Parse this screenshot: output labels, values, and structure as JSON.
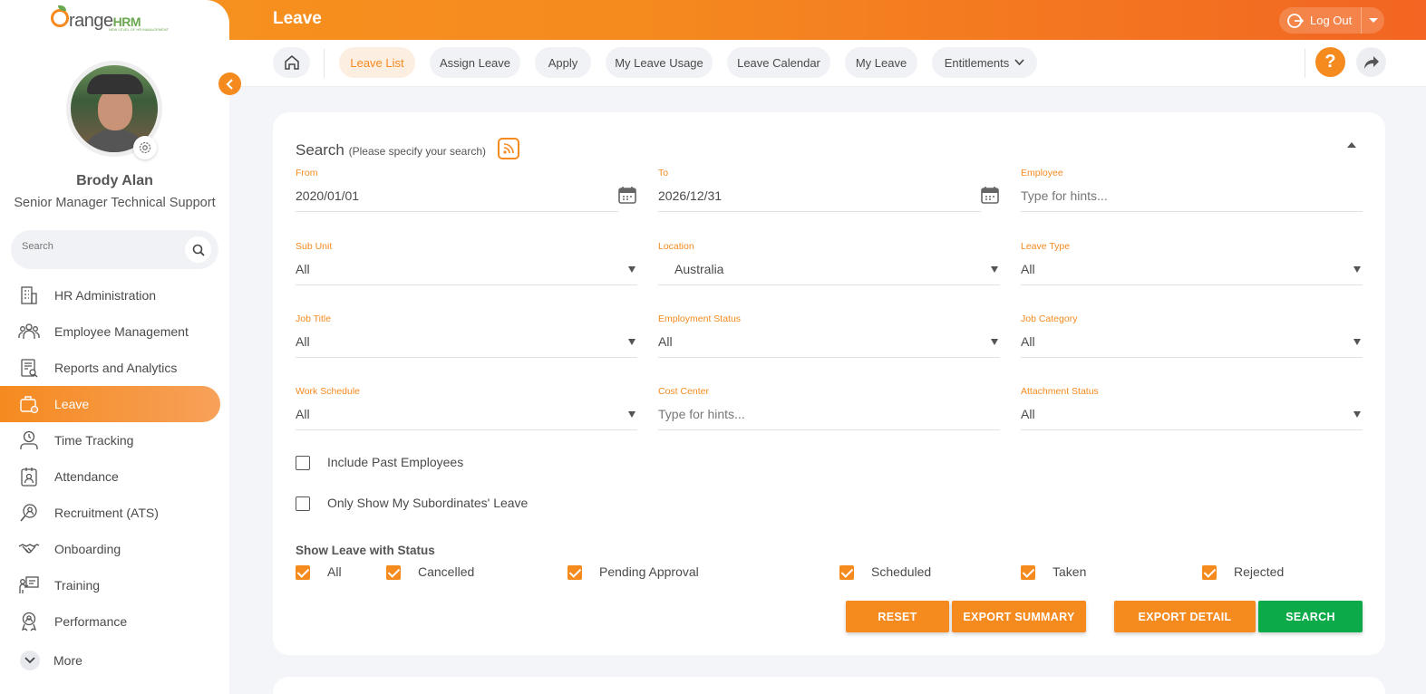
{
  "app": {
    "logo_text": "range",
    "logo_hrm": "HRM",
    "logo_tagline": "NEW LEVEL OF HR MANAGEMENT"
  },
  "header": {
    "title": "Leave",
    "logout_label": "Log Out"
  },
  "user": {
    "name": "Brody Alan",
    "job_title": "Senior Manager Technical Support"
  },
  "sidebar": {
    "search_placeholder": "Search",
    "items": [
      {
        "label": "HR Administration",
        "icon": "building-icon"
      },
      {
        "label": "Employee Management",
        "icon": "people-icon"
      },
      {
        "label": "Reports and Analytics",
        "icon": "report-icon"
      },
      {
        "label": "Leave",
        "icon": "leave-icon",
        "active": true
      },
      {
        "label": "Time Tracking",
        "icon": "clock-user-icon"
      },
      {
        "label": "Attendance",
        "icon": "badge-icon"
      },
      {
        "label": "Recruitment (ATS)",
        "icon": "recruit-icon"
      },
      {
        "label": "Onboarding",
        "icon": "handshake-icon"
      },
      {
        "label": "Training",
        "icon": "training-icon"
      },
      {
        "label": "Performance",
        "icon": "award-icon"
      },
      {
        "label": "More",
        "icon": "chevron-down-icon"
      }
    ]
  },
  "tabs": [
    {
      "label": "Leave List",
      "active": true
    },
    {
      "label": "Assign Leave"
    },
    {
      "label": "Apply"
    },
    {
      "label": "My Leave Usage"
    },
    {
      "label": "Leave Calendar"
    },
    {
      "label": "My Leave"
    },
    {
      "label": "Entitlements"
    }
  ],
  "search": {
    "title": "Search",
    "subtitle": "(Please specify your search)",
    "fields": {
      "from": {
        "label": "From",
        "value": "2020/01/01"
      },
      "to": {
        "label": "To",
        "value": "2026/12/31"
      },
      "employee": {
        "label": "Employee",
        "placeholder": "Type for hints..."
      },
      "sub_unit": {
        "label": "Sub Unit",
        "value": "All"
      },
      "location": {
        "label": "Location",
        "value": "Australia"
      },
      "leave_type": {
        "label": "Leave Type",
        "value": "All"
      },
      "job_title": {
        "label": "Job Title",
        "value": "All"
      },
      "employment_status": {
        "label": "Employment Status",
        "value": "All"
      },
      "job_category": {
        "label": "Job Category",
        "value": "All"
      },
      "work_schedule": {
        "label": "Work Schedule",
        "value": "All"
      },
      "cost_center": {
        "label": "Cost Center",
        "placeholder": "Type for hints..."
      },
      "attachment_status": {
        "label": "Attachment Status",
        "value": "All"
      }
    },
    "include_past_employees": {
      "label": "Include Past Employees",
      "checked": false
    },
    "only_subordinates": {
      "label": "Only Show My Subordinates' Leave",
      "checked": false
    },
    "status_title": "Show Leave with Status",
    "statuses": [
      {
        "label": "All",
        "checked": true
      },
      {
        "label": "Cancelled",
        "checked": true
      },
      {
        "label": "Pending Approval",
        "checked": true
      },
      {
        "label": "Scheduled",
        "checked": true
      },
      {
        "label": "Taken",
        "checked": true
      },
      {
        "label": "Rejected",
        "checked": true
      }
    ],
    "buttons": {
      "reset": "RESET",
      "export_summary": "EXPORT SUMMARY",
      "export_detail": "EXPORT DETAIL",
      "search": "SEARCH"
    }
  },
  "colors": {
    "accent": "#f58a1f",
    "search_button": "#0daa4a",
    "active_tab_bg": "#fdeee2"
  }
}
